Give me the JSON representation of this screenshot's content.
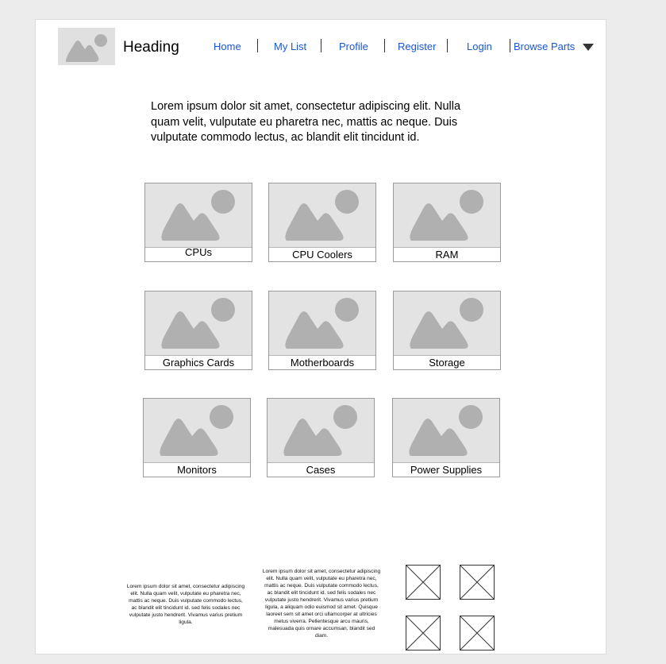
{
  "header": {
    "heading": "Heading",
    "nav": [
      {
        "label": "Home"
      },
      {
        "label": "My List"
      },
      {
        "label": "Profile"
      },
      {
        "label": "Register"
      },
      {
        "label": "Login"
      },
      {
        "label": "Browse Parts"
      }
    ],
    "dropdown_icon": "triangle-down-icon"
  },
  "intro": {
    "text": "Lorem ipsum dolor sit amet, consectetur adipiscing elit. Nulla quam velit, vulputate eu pharetra nec, mattis ac neque. Duis vulputate commodo lectus, ac blandit elit tincidunt id."
  },
  "categories": [
    {
      "label": "CPUs"
    },
    {
      "label": "CPU Coolers"
    },
    {
      "label": "RAM"
    },
    {
      "label": "Graphics Cards"
    },
    {
      "label": "Motherboards"
    },
    {
      "label": "Storage"
    },
    {
      "label": "Monitors"
    },
    {
      "label": "Cases"
    },
    {
      "label": "Power Supplies"
    }
  ],
  "footer": {
    "col1": "Lorem ipsum dolor sit amet, consectetur adipiscing elit. Nulla quam velit, vulputate eu pharetra nec, mattis ac neque. Duis vulputate commodo lectus, ac blandit elit tincidunt id. sed felis sodales nec vulputate justo hendrerit. Vivamus varius pretium ligula.",
    "col2": "Lorem ipsum dolor sit amet, consectetur adipiscing elit. Nulla quam velit, vulputate eu pharetra nec, mattis ac neque. Duis vulputate commodo lectus, ac blandit elit tincidunt id. sed felis sodales nec vulputate justo hendrerit. Vivamus varius pretium ligula, a aliquam odio euismod sit amet. Quisque laoreet sem sit amet orci ullamcorper at ultricies metus viverra. Pellentesque arcu mauris, malesuada quis ornare accumsan, blandit sed diam."
  },
  "colors": {
    "link": "#1a56d6",
    "image_placeholder": "#e3e3e3",
    "image_glyph": "#b0b0b0",
    "background": "#ececec"
  }
}
